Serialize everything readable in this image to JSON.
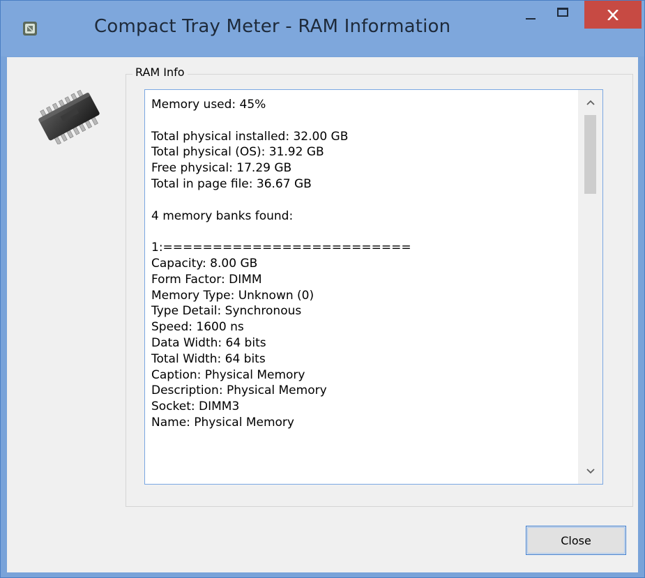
{
  "window": {
    "title": "Compact Tray Meter - RAM Information",
    "accent_color": "#7ea7dc",
    "close_color": "#c74a43"
  },
  "group": {
    "label": "RAM Info"
  },
  "ram_info": {
    "lines": [
      "Memory used: 45%",
      "",
      "Total physical installed: 32.00 GB",
      "Total physical (OS): 31.92 GB",
      "Free physical: 17.29 GB",
      "Total in page file: 36.67 GB",
      "",
      "4 memory banks found:",
      "",
      "1:=========================",
      "Capacity: 8.00 GB",
      "Form Factor: DIMM",
      "Memory Type: Unknown (0)",
      "Type Detail: Synchronous",
      "Speed: 1600 ns",
      "Data Width: 64 bits",
      "Total Width: 64 bits",
      "Caption: Physical Memory",
      "Description: Physical Memory",
      "Socket: DIMM3",
      "Name: Physical Memory"
    ]
  },
  "buttons": {
    "close_label": "Close"
  },
  "icons": {
    "app": "app-icon",
    "chip": "memory-chip-icon",
    "minimize": "minimize-icon",
    "maximize": "maximize-icon",
    "close": "close-icon",
    "scroll_up": "chevron-up-icon",
    "scroll_down": "chevron-down-icon"
  }
}
